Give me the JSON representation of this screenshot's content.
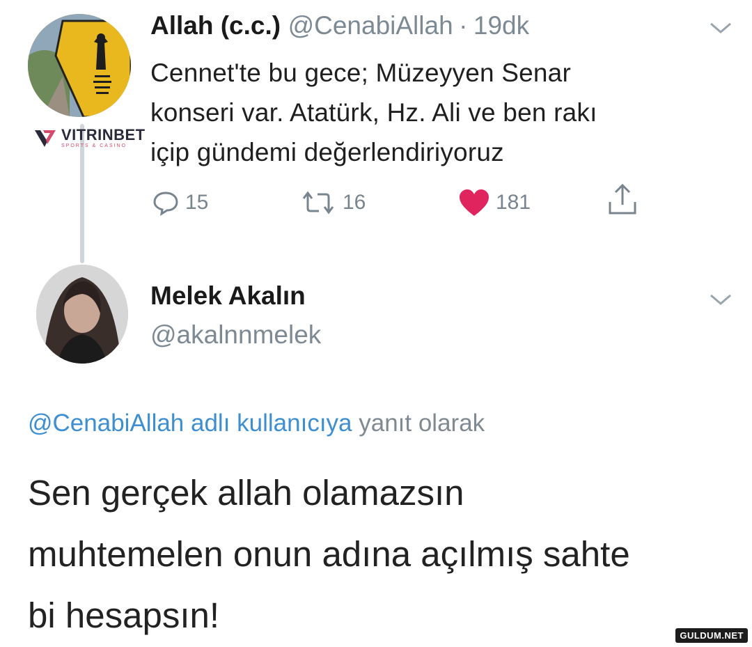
{
  "tweet": {
    "author_name": "Allah (c.c.)",
    "author_handle": "@CenabiAllah",
    "separator": "·",
    "time": "19dk",
    "text_lines": [
      "Cennet'te bu gece; Müzeyyen Senar",
      "konseri var. Atatürk, Hz. Ali ve ben rakı",
      "içip gündemi değerlendiriyoruz"
    ],
    "actions": {
      "replies": "15",
      "retweets": "16",
      "likes": "181"
    },
    "icons": {
      "reply": "reply-icon",
      "retweet": "retweet-icon",
      "like": "heart-icon",
      "share": "share-icon",
      "menu": "chevron-down-icon"
    }
  },
  "reply": {
    "author_name": "Melek Akalın",
    "author_handle": "@akalnnmelek",
    "replying_mention": "@CenabiAllah adlı kullanıcıya",
    "replying_suffix": " yanıt olarak",
    "text_lines": [
      "Sen gerçek allah olamazsın",
      "muhtemelen onun adına açılmış sahte",
      "bi hesapsın!"
    ]
  },
  "watermarks": {
    "vitrinbet": "VITRINBET",
    "vitrinbet_sub": "SPORTS & CASINO",
    "site": "GULDUM.NET"
  },
  "colors": {
    "like_red": "#e0245e",
    "mention_blue": "#3d8fd1",
    "muted_gray": "#7d8a94",
    "avatar_yellow": "#e9b81f"
  }
}
